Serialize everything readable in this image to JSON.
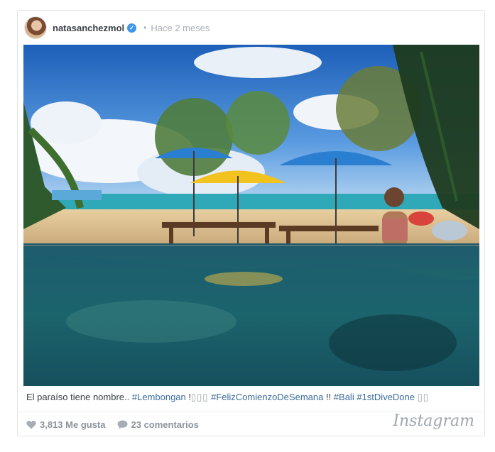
{
  "post": {
    "username": "natasanchezmol",
    "verified_mark": "✓",
    "separator": "•",
    "time": "Hace 2 meses",
    "caption": {
      "text1": "El paraíso tiene nombre.. ",
      "tag1": "#Lembongan",
      "text2": " !",
      "boxes1": "▯▯▯",
      "tag2": "#FelizComienzoDeSemana",
      "text3": " !! ",
      "tag3": "#Bali",
      "tag4": "#1stDiveDone",
      "boxes2": "▯▯"
    },
    "likes": "3,813 Me gusta",
    "comments": "23 comentarios",
    "brand": "Instagram"
  },
  "icons": {
    "avatar": "avatar",
    "verified": "verified-badge-icon",
    "like": "heart-icon",
    "comment": "speech-bubble-icon"
  },
  "colors": {
    "username": "#3a3f44",
    "verified": "#3d95ee",
    "hashtag": "#3b6b9b",
    "muted": "#a9b0b7"
  }
}
